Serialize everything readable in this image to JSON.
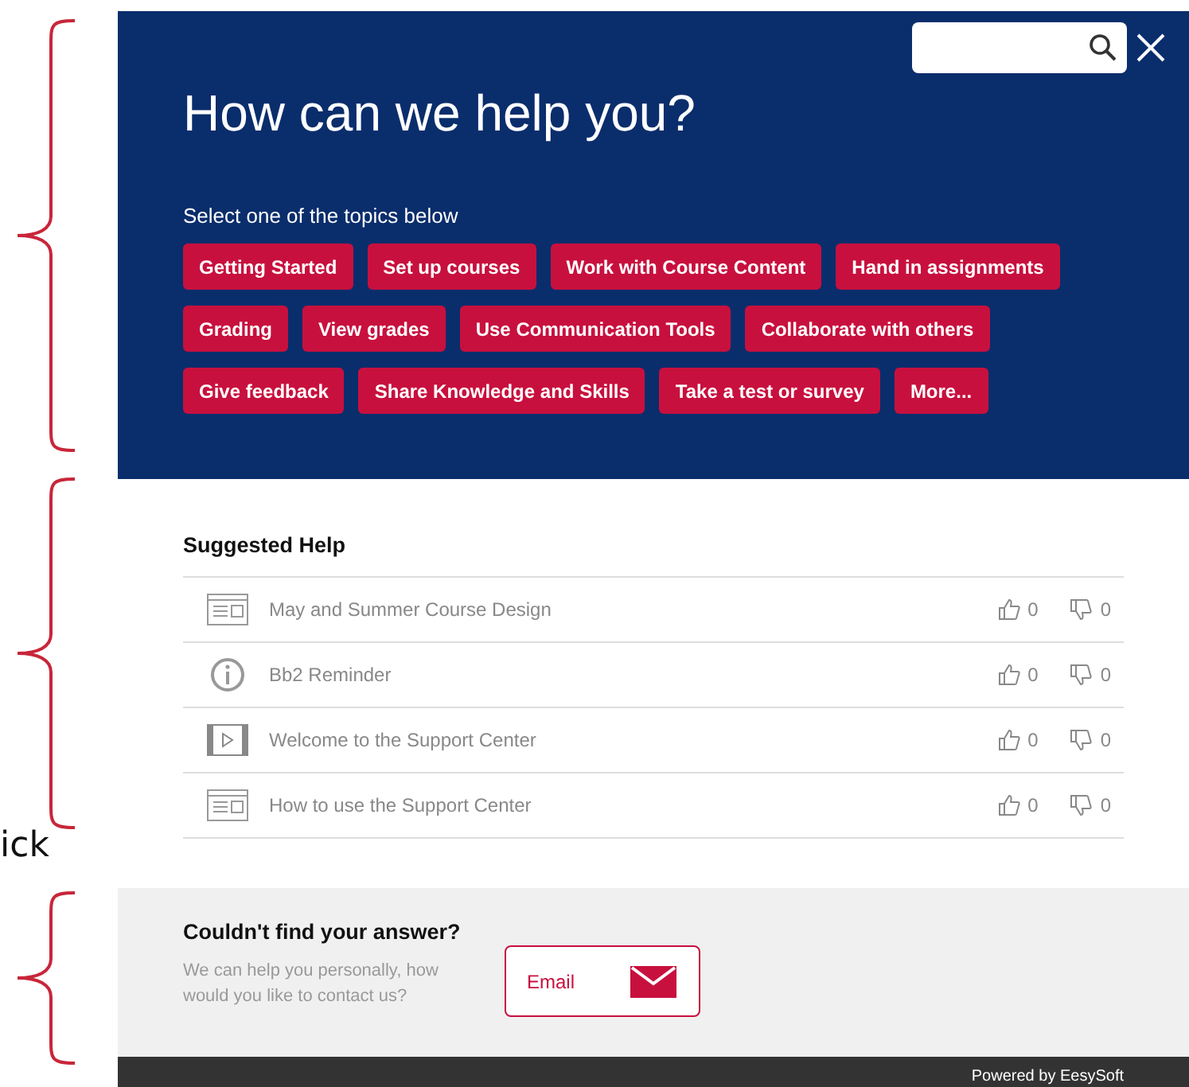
{
  "annotations": {
    "margin_text": "ick"
  },
  "header": {
    "title": "How can we help you?",
    "subtitle": "Select one of the topics below",
    "topics": [
      "Getting Started",
      "Set up courses",
      "Work with Course Content",
      "Hand in assignments",
      "Grading",
      "View grades",
      "Use Communication Tools",
      "Collaborate with others",
      "Give feedback",
      "Share Knowledge and Skills",
      "Take a test or survey",
      "More..."
    ]
  },
  "suggested": {
    "title": "Suggested Help",
    "items": [
      {
        "kind": "article",
        "title": "May and Summer Course Design",
        "likes": "0",
        "dislikes": "0"
      },
      {
        "kind": "info",
        "title": "Bb2 Reminder",
        "likes": "0",
        "dislikes": "0"
      },
      {
        "kind": "video",
        "title": "Welcome to the Support Center",
        "likes": "0",
        "dislikes": "0"
      },
      {
        "kind": "article",
        "title": "How to use the Support Center",
        "likes": "0",
        "dislikes": "0"
      }
    ]
  },
  "contact": {
    "title": "Couldn't find your answer?",
    "text": "We can help you personally, how would you like to contact us?",
    "button": "Email"
  },
  "footer": {
    "text": "Powered by EesySoft"
  }
}
